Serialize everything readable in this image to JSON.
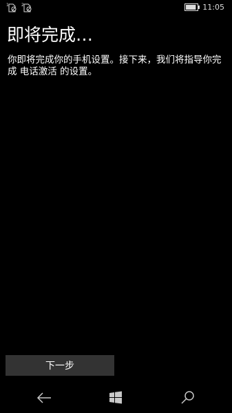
{
  "status_bar": {
    "sim1_icon": "sim-1-no-service-icon",
    "sim2_icon": "sim-2-no-service-icon",
    "battery_icon": "battery-icon",
    "battery_level": 0.9,
    "time": "11:05"
  },
  "page": {
    "title": "即将完成…",
    "body_text": "你即将完成你的手机设置。接下来，我们将指导你完成 电话激活 的设置。"
  },
  "actions": {
    "next_label": "下一步"
  },
  "nav_bar": {
    "back_icon": "back-arrow-icon",
    "start_icon": "windows-start-icon",
    "search_icon": "search-icon"
  },
  "colors": {
    "background": "#000000",
    "text": "#ffffff",
    "button_bg": "#333333",
    "nav_icon": "#c8c8c8"
  }
}
